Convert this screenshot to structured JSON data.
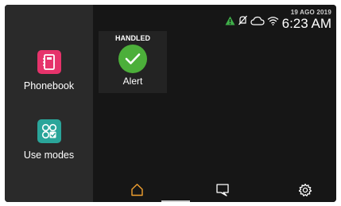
{
  "sidebar": {
    "apps": [
      {
        "label": "Phonebook",
        "icon": "phonebook-icon",
        "color": "#e6336b"
      },
      {
        "label": "Use modes",
        "icon": "use-modes-icon",
        "color": "#2aa59a"
      }
    ]
  },
  "status": {
    "date": "19 AGO 2019",
    "time": "6:23 AM",
    "icons": [
      "warning-icon",
      "mute-icon",
      "cloud-icon",
      "wifi-icon"
    ],
    "warning_color": "#3fae49"
  },
  "alert": {
    "state": "HANDLED",
    "label": "Alert",
    "icon": "checkmark-icon",
    "color": "#4caf3a"
  },
  "nav": {
    "items": [
      {
        "icon": "home-icon",
        "active": true,
        "color": "#f0a030"
      },
      {
        "icon": "message-icon",
        "active": false
      },
      {
        "icon": "settings-icon",
        "active": false
      }
    ]
  }
}
